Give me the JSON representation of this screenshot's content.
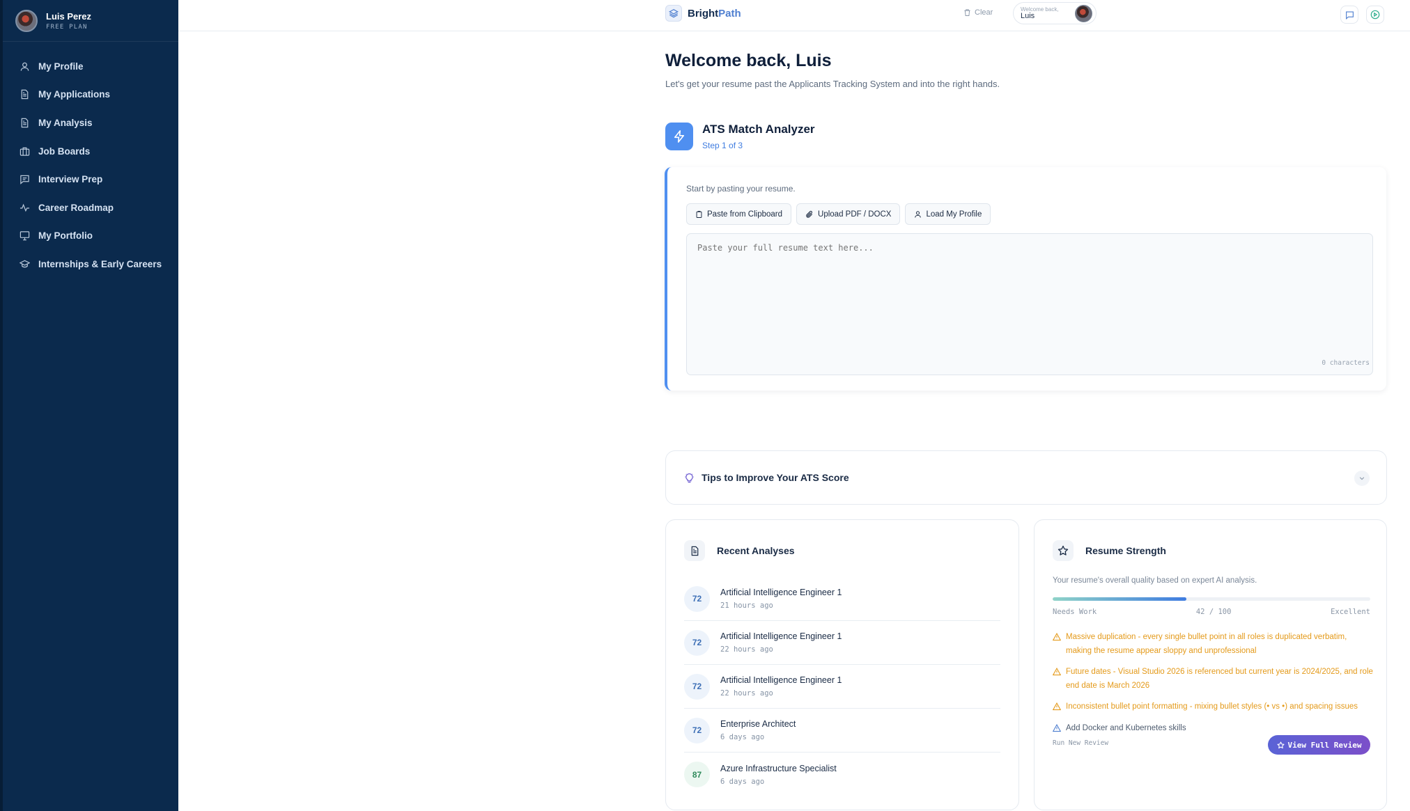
{
  "user": {
    "name": "Luis Perez",
    "plan": "FREE PLAN"
  },
  "sidebar": {
    "items": [
      {
        "label": "My Profile",
        "icon": "user-icon"
      },
      {
        "label": "My Applications",
        "icon": "document-icon"
      },
      {
        "label": "My Analysis",
        "icon": "document-icon"
      },
      {
        "label": "Job Boards",
        "icon": "briefcase-icon"
      },
      {
        "label": "Interview Prep",
        "icon": "chat-icon"
      },
      {
        "label": "Career Roadmap",
        "icon": "activity-icon"
      },
      {
        "label": "My Portfolio",
        "icon": "monitor-icon"
      },
      {
        "label": "Internships & Early Careers",
        "icon": "graduation-cap-icon"
      }
    ]
  },
  "topbar": {
    "brand_main": "Bright",
    "brand_accent": "Path",
    "clear_label": "Clear",
    "welcome_small": "Welcome back,",
    "welcome_name": "Luis"
  },
  "main": {
    "title": "Welcome back, Luis",
    "subtitle": "Let's get your resume past the Applicants Tracking System and into the right hands."
  },
  "analyzer": {
    "title": "ATS Match Analyzer",
    "step": "Step 1 of 3",
    "prompt": "Start by pasting your resume.",
    "buttons": {
      "paste": "Paste from Clipboard",
      "upload": "Upload PDF / DOCX",
      "load": "Load My Profile"
    },
    "textarea_placeholder": "Paste your full resume text here...",
    "char_count": "0 characters"
  },
  "tips": {
    "title": "Tips to Improve Your ATS Score"
  },
  "recent": {
    "title": "Recent Analyses",
    "items": [
      {
        "score": "72",
        "title": "Artificial Intelligence Engineer 1",
        "time": "21 hours ago"
      },
      {
        "score": "72",
        "title": "Artificial Intelligence Engineer 1",
        "time": "22 hours ago"
      },
      {
        "score": "72",
        "title": "Artificial Intelligence Engineer 1",
        "time": "22 hours ago"
      },
      {
        "score": "72",
        "title": "Enterprise Architect",
        "time": "6 days ago"
      },
      {
        "score": "87",
        "title": "Azure Infrastructure Specialist",
        "time": "6 days ago"
      }
    ]
  },
  "strength": {
    "title": "Resume Strength",
    "description": "Your resume's overall quality based on expert AI analysis.",
    "score": 42,
    "score_max": 100,
    "scale_low": "Needs Work",
    "score_text": "42 / 100",
    "scale_high": "Excellent",
    "issues": [
      {
        "text": "Massive duplication - every single bullet point in all roles is duplicated verbatim, making the resume appear sloppy and unprofessional",
        "severity": "warning"
      },
      {
        "text": "Future dates - Visual Studio 2026 is referenced but current year is 2024/2025, and role end date is March 2026",
        "severity": "warning"
      },
      {
        "text": "Inconsistent bullet point formatting - mixing bullet styles (• vs •) and spacing issues",
        "severity": "warning"
      },
      {
        "text": "Add Docker and Kubernetes skills",
        "severity": "info"
      }
    ],
    "run_new": "Run New Review",
    "view_full": "View Full Review"
  },
  "colors": {
    "sidebar": "#0b2a4d",
    "accent": "#4f8ff0",
    "warning": "#e49a1a",
    "review_button": "#6a58d0"
  }
}
